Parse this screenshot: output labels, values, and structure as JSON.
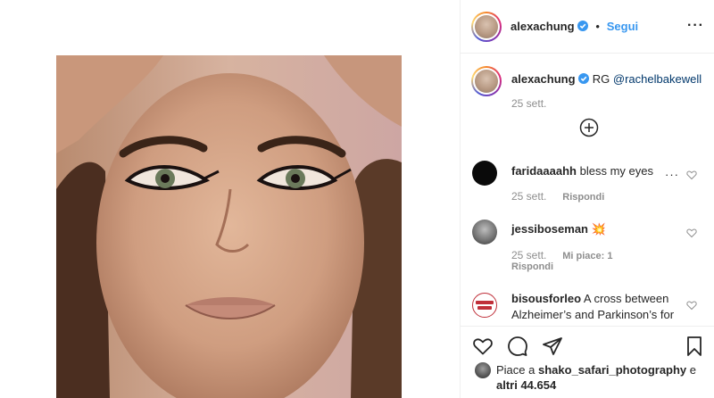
{
  "post": {
    "author": "alexachung",
    "follow_label": "Segui",
    "separator": "•"
  },
  "caption": {
    "author": "alexachung",
    "text": "RG",
    "mention": "@rachelbakewell",
    "date": "25 sett."
  },
  "comments": [
    {
      "author": "faridaaaahh",
      "text": "bless my eyes",
      "date": "25 sett.",
      "reply_label": "Rispondi",
      "likes": ""
    },
    {
      "author": "jessiboseman",
      "text": "💥",
      "date": "25 sett.",
      "likes": "Mi piace: 1",
      "reply_label": "Rispondi"
    },
    {
      "author": "bisousforleo",
      "text": "A cross between Alzheimer’s and Parkinson’s for"
    }
  ],
  "likes": {
    "prefix": "Piace a",
    "user": "shako_safari_photography",
    "connector": "e",
    "others": "altri 44.654"
  },
  "colors": {
    "link": "#3897f0",
    "text": "#262626",
    "muted": "#8e8e8e",
    "border": "#efefef"
  }
}
